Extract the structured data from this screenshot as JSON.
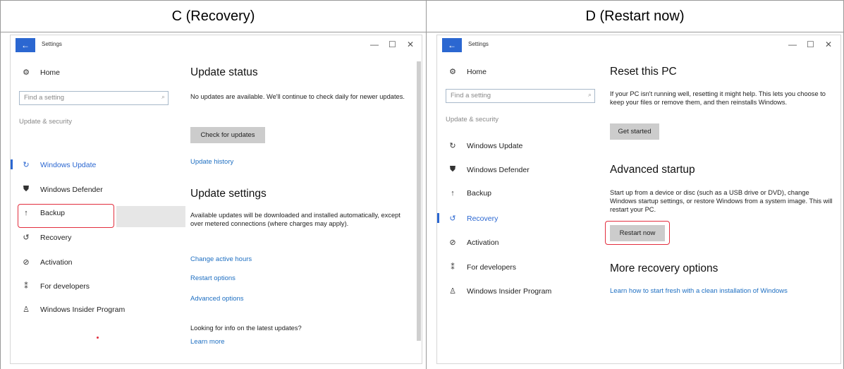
{
  "panels": {
    "left_header": "C (Recovery)",
    "right_header": "D (Restart now)"
  },
  "win_c": {
    "title": "Settings",
    "controls": {
      "minimize": "—",
      "maximize": "☐",
      "close": "✕"
    },
    "home": "Home",
    "search_placeholder": "Find a setting",
    "section": "Update & security",
    "nav": [
      {
        "label": "Windows Update",
        "icon": "sync-icon"
      },
      {
        "label": "Windows Defender",
        "icon": "shield-icon"
      },
      {
        "label": "Backup",
        "icon": "backup-icon"
      },
      {
        "label": "Recovery",
        "icon": "history-icon"
      },
      {
        "label": "Activation",
        "icon": "check-circle-icon"
      },
      {
        "label": "For developers",
        "icon": "developer-icon"
      },
      {
        "label": "Windows Insider Program",
        "icon": "insider-icon"
      }
    ],
    "content": {
      "update_status_title": "Update status",
      "update_status_text": "No updates are available. We'll continue to check daily for newer updates.",
      "check_button": "Check for updates",
      "update_history": "Update history",
      "update_settings_title": "Update settings",
      "update_settings_text": "Available updates will be downloaded and installed automatically, except over metered connections (where charges may apply).",
      "change_active_hours": "Change active hours",
      "restart_options": "Restart options",
      "advanced_options": "Advanced options",
      "looking_text": "Looking for info on the latest updates?",
      "learn_more": "Learn more"
    }
  },
  "win_d": {
    "title": "Settings",
    "controls": {
      "minimize": "—",
      "maximize": "☐",
      "close": "✕"
    },
    "home": "Home",
    "search_placeholder": "Find a setting",
    "section": "Update & security",
    "nav": [
      {
        "label": "Windows Update",
        "icon": "sync-icon"
      },
      {
        "label": "Windows Defender",
        "icon": "shield-icon"
      },
      {
        "label": "Backup",
        "icon": "backup-icon"
      },
      {
        "label": "Recovery",
        "icon": "history-icon"
      },
      {
        "label": "Activation",
        "icon": "check-circle-icon"
      },
      {
        "label": "For developers",
        "icon": "developer-icon"
      },
      {
        "label": "Windows Insider Program",
        "icon": "insider-icon"
      }
    ],
    "content": {
      "reset_title": "Reset this PC",
      "reset_text": "If your PC isn't running well, resetting it might help. This lets you choose to keep your files or remove them, and then reinstalls Windows.",
      "get_started": "Get started",
      "advanced_title": "Advanced startup",
      "advanced_text": "Start up from a device or disc (such as a USB drive or DVD), change Windows startup settings, or restore Windows from a system image. This will restart your PC.",
      "restart_now": "Restart now",
      "more_title": "More recovery options",
      "more_link": "Learn how to start fresh with a clean installation of Windows"
    }
  },
  "colors": {
    "accent": "#2b67d1",
    "link": "#1e6fc2",
    "highlight": "#e22e3e"
  }
}
